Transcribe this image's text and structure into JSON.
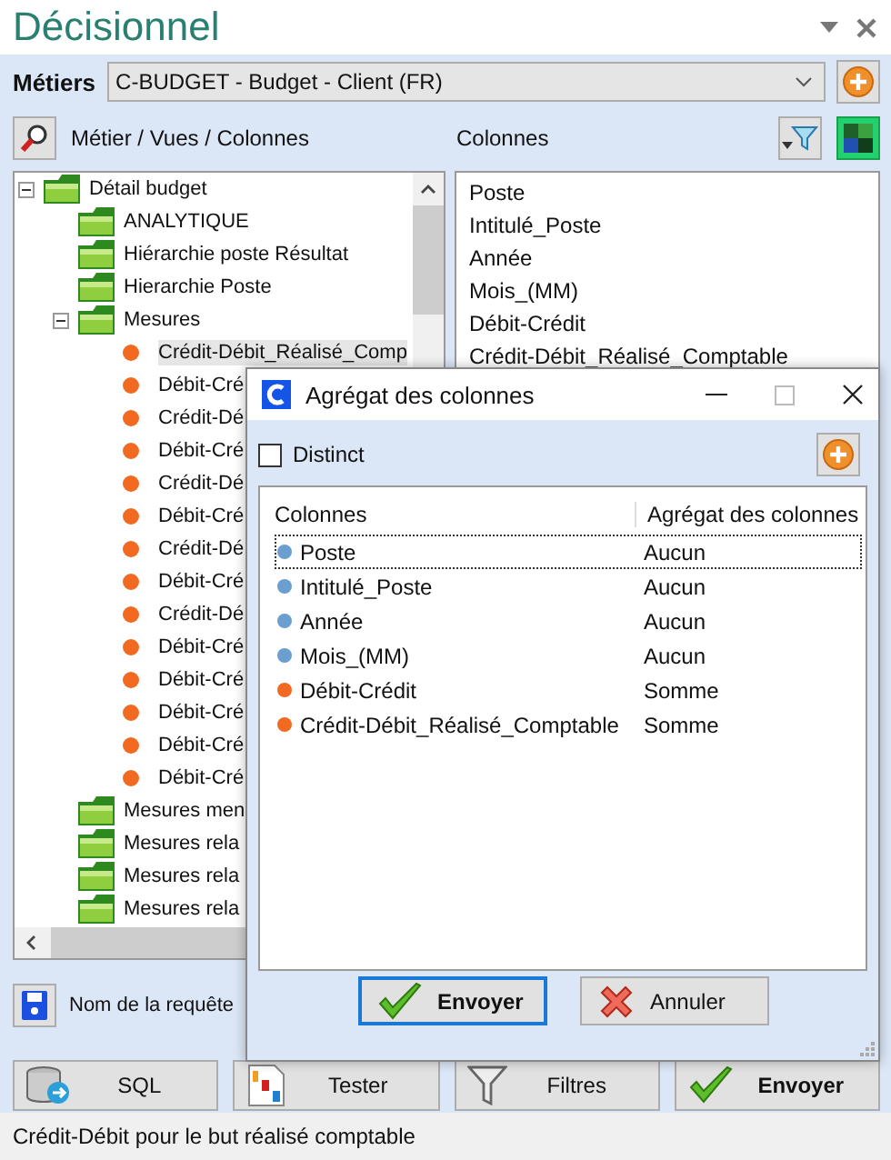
{
  "window": {
    "title": "Décisionnel"
  },
  "metiers": {
    "label": "Métiers",
    "value": "C-BUDGET - Budget - Client (FR)"
  },
  "toolbar": {
    "left_label": "Métier / Vues / Colonnes",
    "right_label": "Colonnes"
  },
  "tree": [
    {
      "label": "Détail budget",
      "kind": "folder",
      "expanded": true,
      "children": [
        {
          "label": "ANALYTIQUE",
          "kind": "folder"
        },
        {
          "label": "Hiérarchie poste Résultat",
          "kind": "folder"
        },
        {
          "label": "Hierarchie Poste",
          "kind": "folder"
        },
        {
          "label": "Mesures",
          "kind": "folder",
          "expanded": true,
          "children": [
            {
              "label": "Crédit-Débit_Réalisé_Comp",
              "kind": "measure",
              "selected": true
            },
            {
              "label": "Débit-Cré",
              "kind": "measure",
              "selected": false
            },
            {
              "label": "Crédit-Dé",
              "kind": "measure",
              "selected": false
            },
            {
              "label": "Débit-Cré",
              "kind": "measure",
              "selected": false
            },
            {
              "label": "Crédit-Dé",
              "kind": "measure",
              "selected": false
            },
            {
              "label": "Débit-Cré",
              "kind": "measure",
              "selected": false
            },
            {
              "label": "Crédit-Dé",
              "kind": "measure",
              "selected": false
            },
            {
              "label": "Débit-Cré",
              "kind": "measure",
              "selected": false
            },
            {
              "label": "Crédit-Dé",
              "kind": "measure",
              "selected": false
            },
            {
              "label": "Débit-Cré",
              "kind": "measure",
              "selected": false
            },
            {
              "label": "Débit-Cré",
              "kind": "measure",
              "selected": false
            },
            {
              "label": "Débit-Cré",
              "kind": "measure",
              "selected": false
            },
            {
              "label": "Débit-Cré",
              "kind": "measure",
              "selected": false
            },
            {
              "label": "Débit-Cré",
              "kind": "measure",
              "selected": false
            }
          ]
        },
        {
          "label": "Mesures men",
          "kind": "folder"
        },
        {
          "label": "Mesures rela",
          "kind": "folder"
        },
        {
          "label": "Mesures rela",
          "kind": "folder"
        },
        {
          "label": "Mesures rela",
          "kind": "folder"
        }
      ]
    }
  ],
  "columns_list": [
    "Poste",
    "Intitulé_Poste",
    "Année",
    "Mois_(MM)",
    "Débit-Crédit",
    "Crédit-Débit_Réalisé_Comptable"
  ],
  "query_name": {
    "label": "Nom de la requête"
  },
  "buttons": [
    {
      "label": "SQL",
      "kind": "sql",
      "bold": false
    },
    {
      "label": "Tester",
      "kind": "test",
      "bold": false
    },
    {
      "label": "Filtres",
      "kind": "filter",
      "bold": false
    },
    {
      "label": "Envoyer",
      "kind": "send",
      "bold": true
    }
  ],
  "status_bar": "Crédit-Débit pour le but réalisé comptable",
  "dialog": {
    "title": "Agrégat des colonnes",
    "distinct": {
      "label": "Distinct",
      "checked": false
    },
    "table": {
      "columns": [
        "Colonnes",
        "Agrégat des colonnes"
      ],
      "rows": [
        {
          "name": "Poste",
          "aggregate": "Aucun",
          "kind": "dimension",
          "selected": true
        },
        {
          "name": "Intitulé_Poste",
          "aggregate": "Aucun",
          "kind": "dimension",
          "selected": false
        },
        {
          "name": "Année",
          "aggregate": "Aucun",
          "kind": "dimension",
          "selected": false
        },
        {
          "name": "Mois_(MM)",
          "aggregate": "Aucun",
          "kind": "dimension",
          "selected": false
        },
        {
          "name": "Débit-Crédit",
          "aggregate": "Somme",
          "kind": "measure",
          "selected": false
        },
        {
          "name": "Crédit-Débit_Réalisé_Comptable",
          "aggregate": "Somme",
          "kind": "measure",
          "selected": false
        }
      ]
    },
    "buttons": [
      {
        "label": "Envoyer",
        "kind": "send",
        "default": true
      },
      {
        "label": "Annuler",
        "kind": "cancel",
        "default": false
      }
    ]
  }
}
